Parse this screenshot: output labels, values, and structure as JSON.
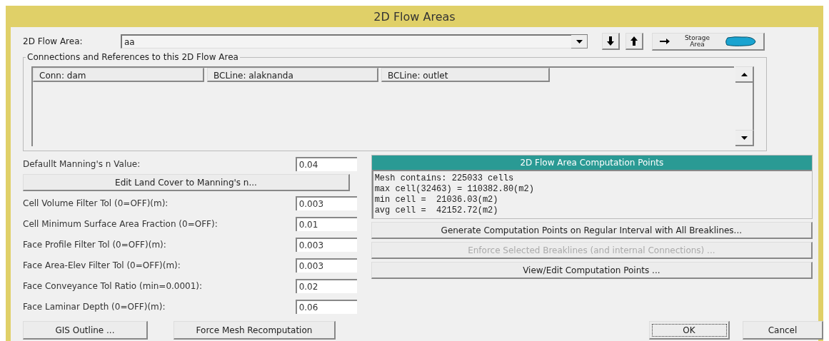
{
  "window": {
    "title": "2D Flow Areas"
  },
  "flow_area": {
    "label": "2D Flow Area:",
    "value": "aa",
    "storage_button": [
      "Storage",
      "Area"
    ]
  },
  "connections": {
    "title": "Connections and References to this 2D Flow Area",
    "items": [
      "Conn: dam",
      "BCLine: alaknanda",
      "BCLine: outlet"
    ]
  },
  "settings": [
    {
      "kind": "field",
      "label": "Defaullt Manning's n Value:",
      "value": "0.04"
    },
    {
      "kind": "button",
      "label": "Edit Land Cover to Manning's n..."
    },
    {
      "kind": "field",
      "label": "Cell Volume Filter Tol (0=OFF)(m):",
      "value": "0.003"
    },
    {
      "kind": "field",
      "label": "Cell Minimum Surface Area Fraction (0=OFF):",
      "value": "0.01"
    },
    {
      "kind": "field",
      "label": "Face Profile Filter Tol (0=OFF)(m):",
      "value": "0.003"
    },
    {
      "kind": "field",
      "label": "Face Area-Elev Filter Tol (0=OFF)(m):",
      "value": "0.003"
    },
    {
      "kind": "field",
      "label": "Face Conveyance Tol Ratio (min=0.0001):",
      "value": "0.02"
    },
    {
      "kind": "field",
      "label": "Face Laminar Depth (0=OFF)(m):",
      "value": "0.06"
    }
  ],
  "computation_points": {
    "title": "2D Flow Area Computation Points",
    "lines": [
      "Mesh contains: 225033 cells",
      "max cell(32463) = 110382.80(m2)",
      "min cell =  21036.03(m2)",
      "avg cell =  42152.72(m2)"
    ],
    "buttons": [
      {
        "label": "Generate Computation Points on Regular Interval with All Breaklines...",
        "disabled": false
      },
      {
        "label": "Enforce Selected Breaklines (and internal Connections) ...",
        "disabled": true
      },
      {
        "label": "View/Edit Computation Points ...",
        "disabled": false
      }
    ]
  },
  "left_buttons": [
    "GIS Outline ...",
    "Force Mesh Recomputation"
  ],
  "dialog_buttons": [
    {
      "label": "OK",
      "focused": true
    },
    {
      "label": "Cancel",
      "focused": false
    }
  ]
}
